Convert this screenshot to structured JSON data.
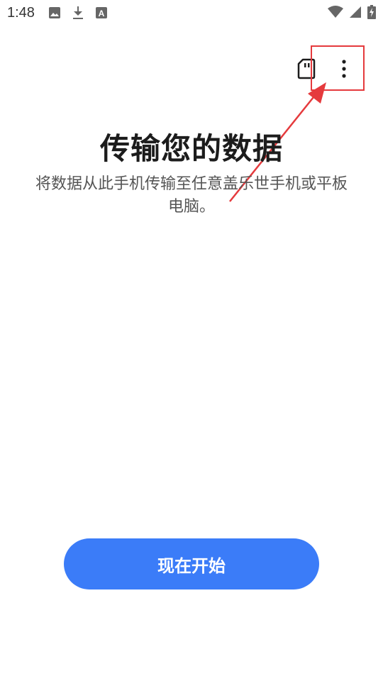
{
  "status_bar": {
    "time": "1:48",
    "left_icons": [
      "image-icon",
      "download-icon",
      "font-icon"
    ],
    "right_icons": [
      "wifi-icon",
      "signal-icon",
      "battery-charging-icon"
    ]
  },
  "toolbar": {
    "icons": [
      "sd-card-icon",
      "more-vert-icon"
    ]
  },
  "main": {
    "title": "传输您的数据",
    "description": "将数据从此手机传输至任意盖乐世手机或平板电脑。"
  },
  "start_button": {
    "label": "现在开始"
  },
  "colors": {
    "accent": "#3b7cf8",
    "annotation": "#e53a3d"
  }
}
